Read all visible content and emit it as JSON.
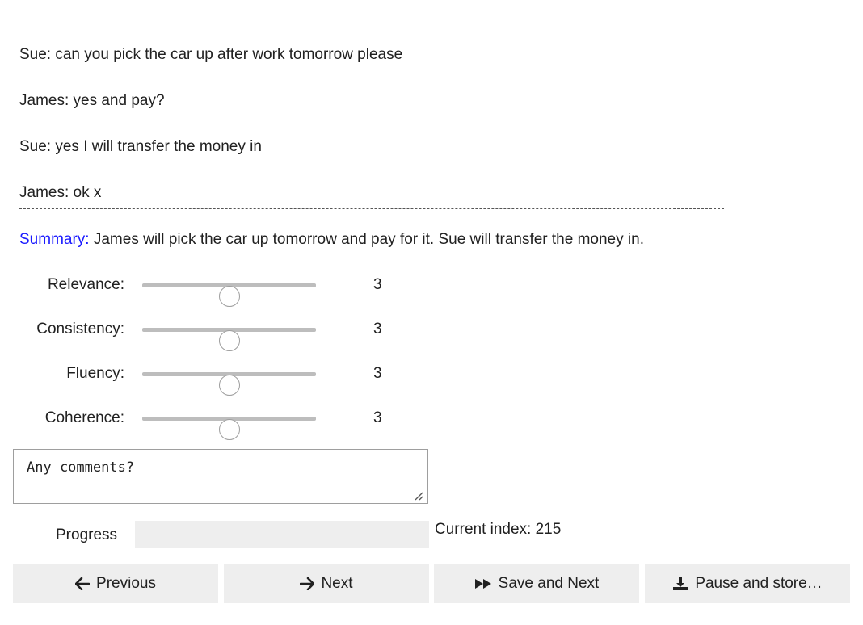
{
  "dialogue": [
    "Sue: can you pick the car up after work tomorrow please",
    "James: yes and pay?",
    "Sue: yes I will transfer the money in",
    "James: ok x"
  ],
  "summary": {
    "label": "Summary:",
    "text": " James will pick the car up tomorrow and pay for it. Sue will transfer the money in."
  },
  "sliders": [
    {
      "label": "Relevance:",
      "value": 3,
      "min": 1,
      "max": 5
    },
    {
      "label": "Consistency:",
      "value": 3,
      "min": 1,
      "max": 5
    },
    {
      "label": "Fluency:",
      "value": 3,
      "min": 1,
      "max": 5
    },
    {
      "label": "Coherence:",
      "value": 3,
      "min": 1,
      "max": 5
    }
  ],
  "comments": {
    "placeholder": "Any comments?",
    "value": ""
  },
  "progress": {
    "label": "Progress",
    "fraction": 0
  },
  "current_index": "Current index: 215",
  "buttons": {
    "previous": "Previous",
    "next": "Next",
    "save_next": "Save and Next",
    "pause_store": "Pause and store…"
  },
  "colors": {
    "summary_label": "#1a1aff",
    "button_bg": "#eeeeee",
    "progress_fill": "#2196f3"
  }
}
